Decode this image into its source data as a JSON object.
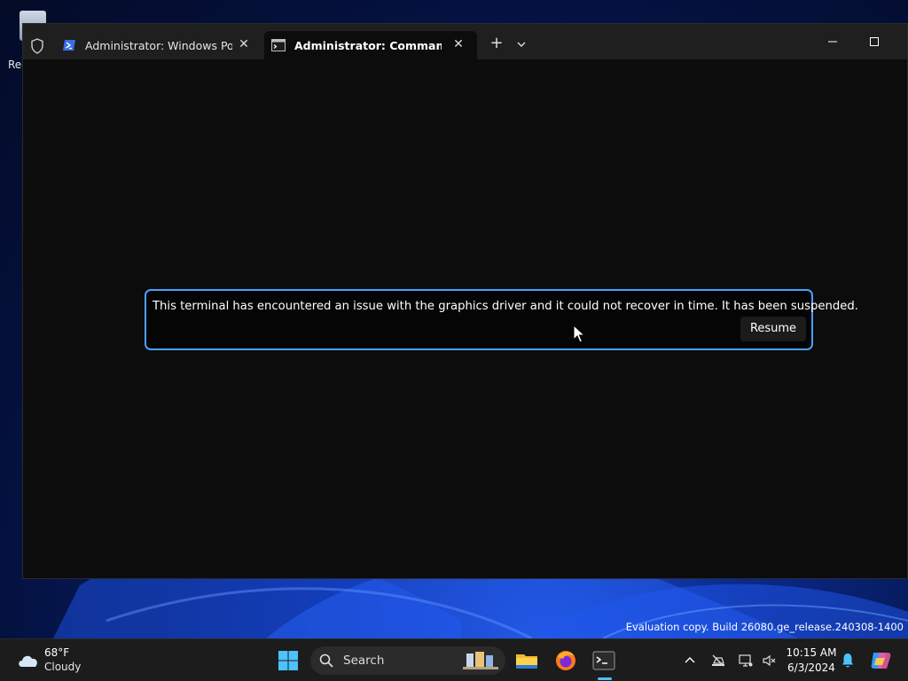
{
  "desktop": {
    "icon_label": "Rec",
    "watermark": "Evaluation copy. Build 26080.ge_release.240308-1400"
  },
  "window": {
    "tabs": [
      {
        "label": "Administrator: Windows PowerShell",
        "icon": "powershell-icon",
        "active": false
      },
      {
        "label": "Administrator: Command Prompt",
        "icon": "cmd-icon",
        "active": true
      }
    ],
    "new_tab": "+",
    "close_glyph": "✕"
  },
  "dialog": {
    "message": "This terminal has encountered an issue with the graphics driver and it could not recover in time. It has been suspended.",
    "resume_label": "Resume"
  },
  "taskbar": {
    "weather_temp": "68°F",
    "weather_condition": "Cloudy",
    "search_label": "Search",
    "clock_time": "10:15 AM",
    "clock_date": "6/3/2024"
  },
  "colors": {
    "accent": "#4aa0ff",
    "terminal_bg": "#0c0c0c",
    "taskbar_bg": "#1c1c1c"
  }
}
